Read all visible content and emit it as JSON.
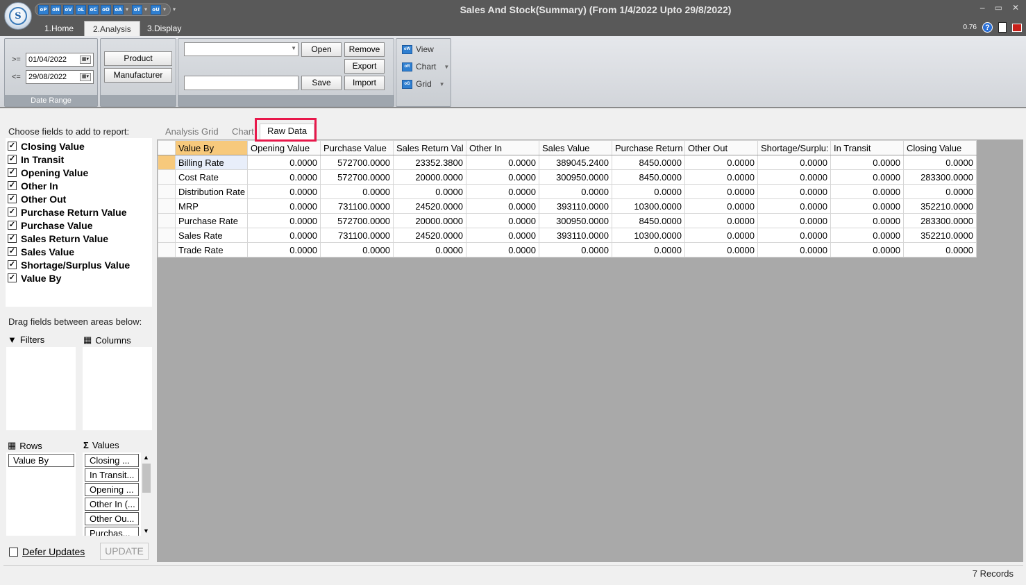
{
  "window": {
    "title": "Sales And Stock(Summary) (From 1/4/2022 Upto 29/8/2022)",
    "orb_letter": "S",
    "controls": [
      "–",
      "▭",
      "✕"
    ]
  },
  "quick_access": [
    "oP",
    "oN",
    "oV",
    "oL",
    "oC",
    "oO",
    "oA",
    "oT",
    "oU"
  ],
  "ribbon_tabs": [
    "1.Home",
    "2.Analysis",
    "3.Display"
  ],
  "ribbon_tabs_active": "2.Analysis",
  "version": "0.76",
  "date_range": {
    "from_label": ">=",
    "from_value": "01/04/2022",
    "to_label": "<=",
    "to_value": "29/08/2022",
    "group_label": "Date Range"
  },
  "filters_group": {
    "product": "Product",
    "manufacturer": "Manufacturer"
  },
  "layout_group": {
    "open": "Open",
    "remove": "Remove",
    "export": "Export",
    "save": "Save",
    "import": "Import"
  },
  "view_group": {
    "view": "View",
    "chart": "Chart",
    "grid": "Grid",
    "view_icon": "oW",
    "chart_icon": "oR",
    "grid_icon": "oG"
  },
  "left_panel": {
    "choose_label": "Choose fields to add to report:",
    "fields": [
      "Closing Value",
      "In Transit",
      "Opening Value",
      "Other In",
      "Other Out",
      "Purchase Return Value",
      "Purchase Value",
      "Sales Return Value",
      "Sales Value",
      "Shortage/Surplus Value",
      "Value By"
    ],
    "drag_label": "Drag fields between areas below:",
    "filters_label": "Filters",
    "columns_label": "Columns",
    "rows_label": "Rows",
    "values_label": "Values",
    "rows_items": [
      "Value By"
    ],
    "values_items": [
      "Closing ...",
      "In Transit...",
      "Opening ...",
      "Other In (...",
      "Other Ou...",
      "Purchas..."
    ],
    "defer_label": "Defer Updates",
    "update_label": "UPDATE"
  },
  "sub_tabs": [
    "Analysis Grid",
    "Chart",
    "Raw Data"
  ],
  "sub_tab_active": "Raw Data",
  "grid": {
    "columns": [
      "Value By",
      "Opening Value",
      "Purchase Value",
      "Sales Return Val",
      "Other In",
      "Sales Value",
      "Purchase Return",
      "Other Out",
      "Shortage/Surplu:",
      "In Transit",
      "Closing Value"
    ],
    "rows": [
      [
        "Billing Rate",
        "0.0000",
        "572700.0000",
        "23352.3800",
        "0.0000",
        "389045.2400",
        "8450.0000",
        "0.0000",
        "0.0000",
        "0.0000",
        "0.0000"
      ],
      [
        "Cost Rate",
        "0.0000",
        "572700.0000",
        "20000.0000",
        "0.0000",
        "300950.0000",
        "8450.0000",
        "0.0000",
        "0.0000",
        "0.0000",
        "283300.0000"
      ],
      [
        "Distribution Rate",
        "0.0000",
        "0.0000",
        "0.0000",
        "0.0000",
        "0.0000",
        "0.0000",
        "0.0000",
        "0.0000",
        "0.0000",
        "0.0000"
      ],
      [
        "MRP",
        "0.0000",
        "731100.0000",
        "24520.0000",
        "0.0000",
        "393110.0000",
        "10300.0000",
        "0.0000",
        "0.0000",
        "0.0000",
        "352210.0000"
      ],
      [
        "Purchase Rate",
        "0.0000",
        "572700.0000",
        "20000.0000",
        "0.0000",
        "300950.0000",
        "8450.0000",
        "0.0000",
        "0.0000",
        "0.0000",
        "283300.0000"
      ],
      [
        "Sales Rate",
        "0.0000",
        "731100.0000",
        "24520.0000",
        "0.0000",
        "393110.0000",
        "10300.0000",
        "0.0000",
        "0.0000",
        "0.0000",
        "352210.0000"
      ],
      [
        "Trade Rate",
        "0.0000",
        "0.0000",
        "0.0000",
        "0.0000",
        "0.0000",
        "0.0000",
        "0.0000",
        "0.0000",
        "0.0000",
        "0.0000"
      ]
    ]
  },
  "status": {
    "records": "7 Records"
  },
  "colors": {
    "highlight": "#e8184b",
    "header_accent": "#f7c97c",
    "titlebar": "#595959",
    "workspace": "#a9a9a9"
  }
}
